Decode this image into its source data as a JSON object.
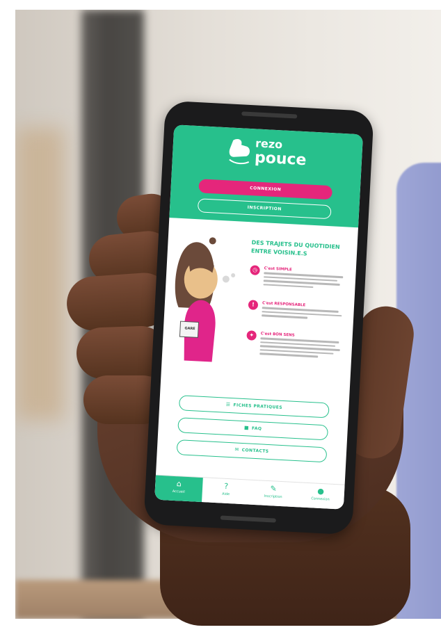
{
  "app": {
    "brand_line1": "rezo",
    "brand_line2": "pouce",
    "connect_label": "CONNEXION",
    "signup_label": "INSCRIPTION",
    "headline": "DES TRAJETS DU QUOTIDIEN ENTRE VOISIN.E.S",
    "features": [
      {
        "icon": "clock-icon",
        "glyph": "◷",
        "title": "C'est SIMPLE"
      },
      {
        "icon": "alert-icon",
        "glyph": "!",
        "title": "C'est RESPONSABLE"
      },
      {
        "icon": "bulb-icon",
        "glyph": "✦",
        "title": "C'est BON SENS"
      }
    ],
    "sign_text": "GARE",
    "links": {
      "practical_label": "FICHES PRATIQUES",
      "faq_label": "FAQ",
      "contact_label": "CONTACTS"
    },
    "tabs": [
      {
        "label": "Accueil",
        "icon": "home-icon",
        "glyph": "⌂"
      },
      {
        "label": "Aide",
        "icon": "help-icon",
        "glyph": "?"
      },
      {
        "label": "Inscription",
        "icon": "pencil-icon",
        "glyph": "✎"
      },
      {
        "label": "Connexion",
        "icon": "user-icon",
        "glyph": "●"
      }
    ]
  },
  "colors": {
    "brand_green": "#27c08c",
    "brand_pink": "#e5267b"
  }
}
